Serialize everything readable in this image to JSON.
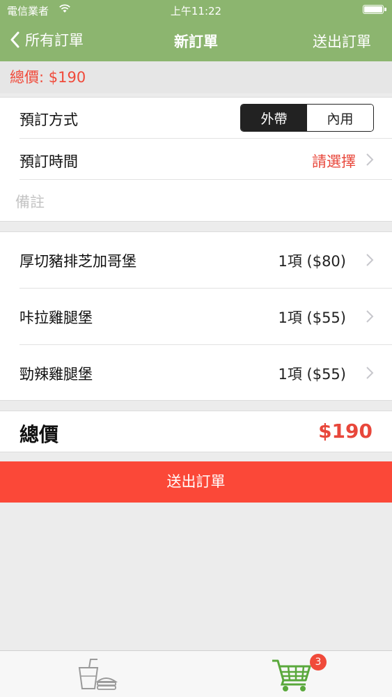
{
  "status_bar": {
    "carrier": "電信業者",
    "time": "上午11:22"
  },
  "nav": {
    "back_label": "所有訂單",
    "title": "新訂單",
    "submit_label": "送出訂單"
  },
  "summary": {
    "total_text": "總價: $190"
  },
  "order_options": {
    "method_label": "預訂方式",
    "method_options": [
      "外帶",
      "內用"
    ],
    "method_selected": "外帶",
    "time_label": "預訂時間",
    "time_value": "請選擇",
    "notes_placeholder": "備註"
  },
  "items": [
    {
      "name": "厚切豬排芝加哥堡",
      "qty_price": "1項 ($80)"
    },
    {
      "name": "咔拉雞腿堡",
      "qty_price": "1項 ($55)"
    },
    {
      "name": "勁辣雞腿堡",
      "qty_price": "1項 ($55)"
    }
  ],
  "grand_total": {
    "label": "總價",
    "value": "$190"
  },
  "submit_button": {
    "label": "送出訂單"
  },
  "tab_bar": {
    "tabs": [
      {
        "icon": "drink-burger-icon"
      },
      {
        "icon": "shopping-cart-icon",
        "badge": "3"
      }
    ]
  },
  "colors": {
    "nav_green": "#8cb56f",
    "accent_red": "#e8473b",
    "submit_red": "#fb4838",
    "cart_green": "#5aa83c"
  }
}
